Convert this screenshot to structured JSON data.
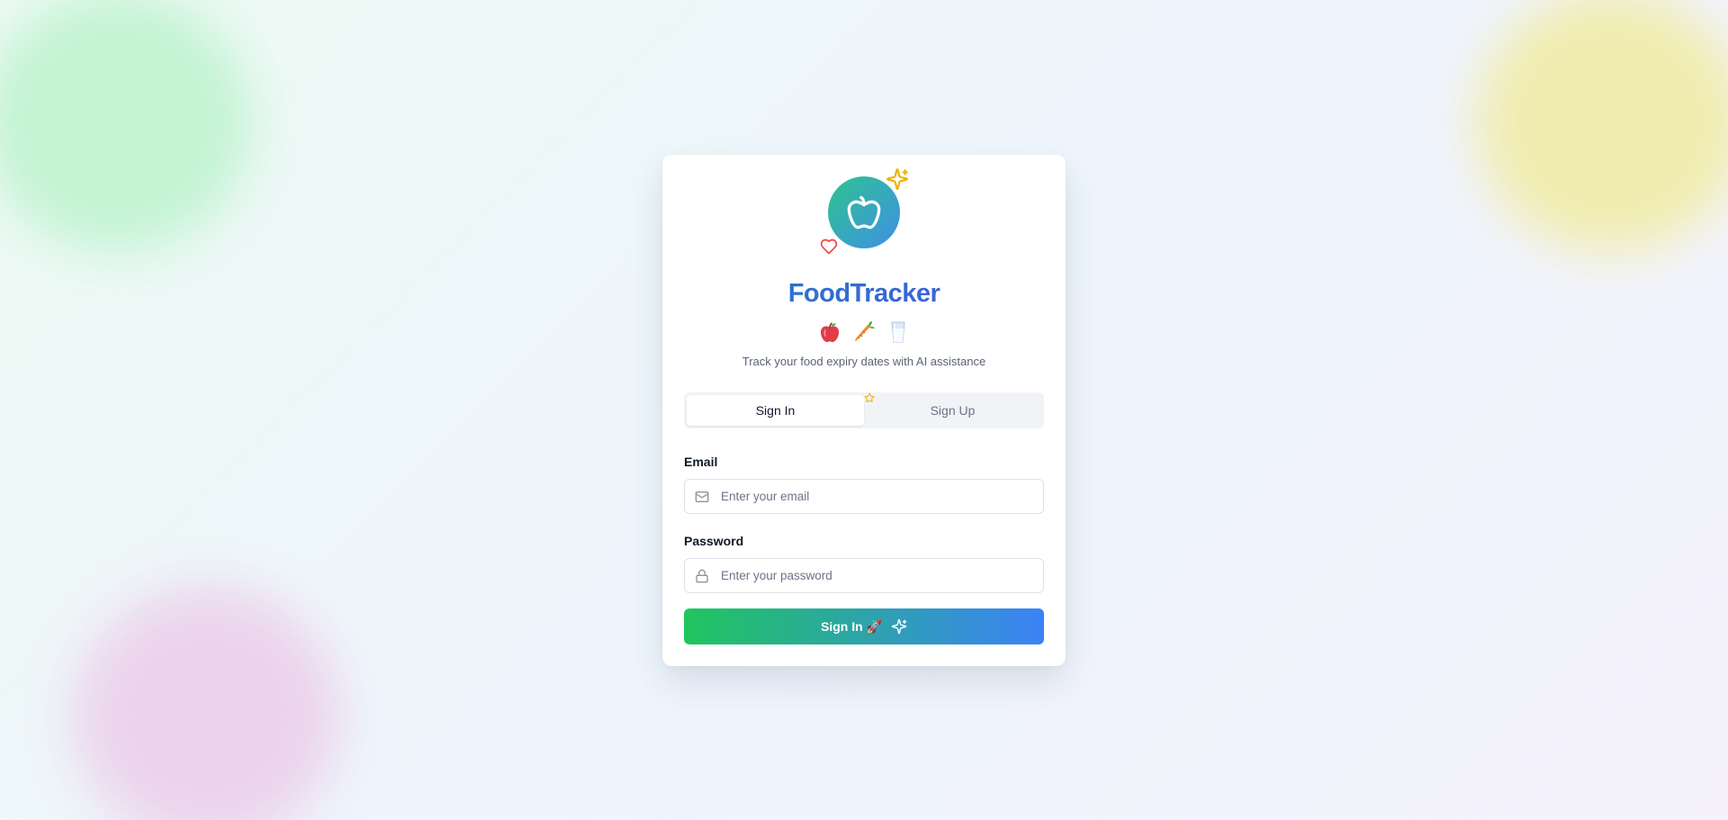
{
  "app": {
    "title": "FoodTracker",
    "subtitle": "Track your food expiry dates with AI assistance",
    "logo_icon": "apple-icon",
    "decor_icons": [
      "sparkles-icon",
      "heart-icon",
      "star-icon"
    ],
    "food_emojis": [
      "apple",
      "carrot",
      "glass-of-milk"
    ]
  },
  "tabs": [
    {
      "label": "Sign In",
      "active": true
    },
    {
      "label": "Sign Up",
      "active": false
    }
  ],
  "form": {
    "email": {
      "label": "Email",
      "placeholder": "Enter your email",
      "value": "",
      "icon": "mail-icon"
    },
    "password": {
      "label": "Password",
      "placeholder": "Enter your password",
      "value": "",
      "icon": "lock-icon"
    },
    "submit": {
      "label": "Sign In 🚀",
      "icon": "sparkles-icon"
    }
  },
  "colors": {
    "brand_gradient_start": "#20c55e",
    "brand_gradient_end": "#3b82f6",
    "title_gradient_start": "#1d7fc4",
    "title_gradient_end": "#4a57e2",
    "sparkle": "#eab308",
    "heart": "#ef4444"
  }
}
